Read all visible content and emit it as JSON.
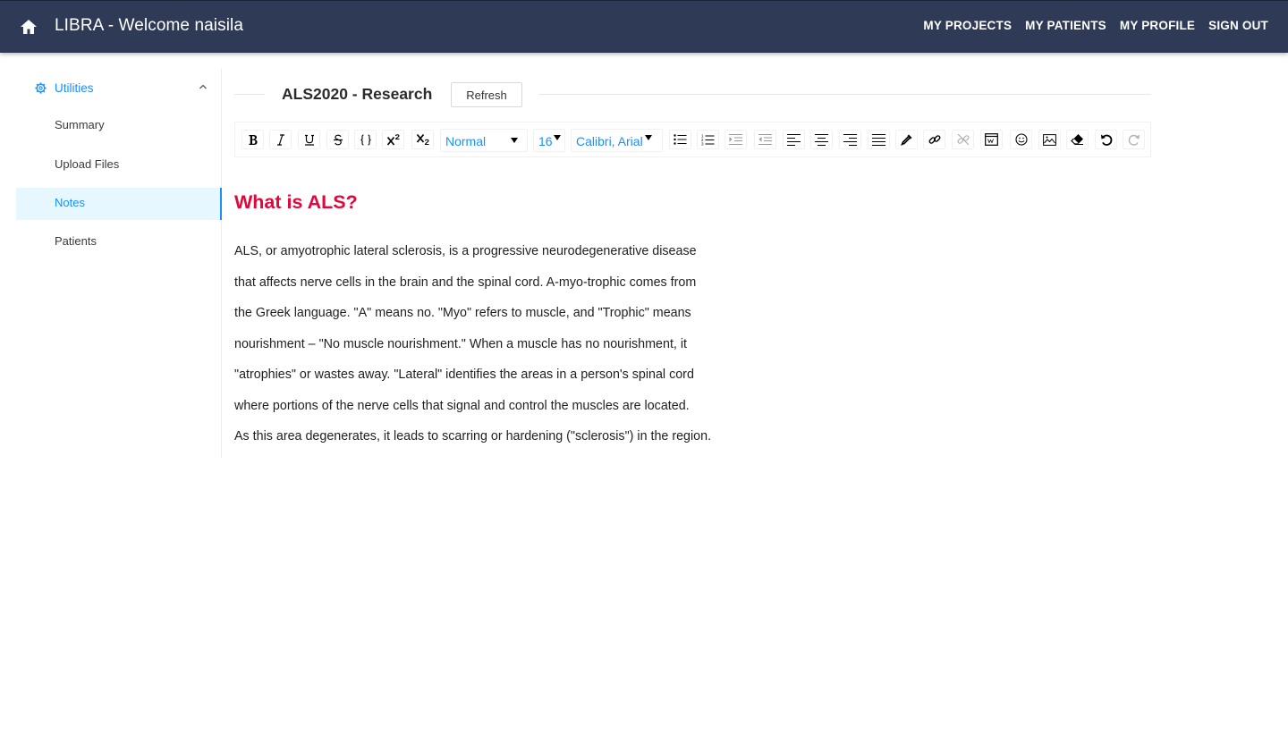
{
  "header": {
    "title": "LIBRA - Welcome naisila",
    "nav": [
      "MY PROJECTS",
      "MY PATIENTS",
      "MY PROFILE",
      "SIGN OUT"
    ],
    "background_color": "#2e3a56"
  },
  "sidebar": {
    "submenu": {
      "label": "Utilities",
      "icon": "gear-icon",
      "expanded": true
    },
    "items": [
      {
        "label": "Summary",
        "active": false
      },
      {
        "label": "Upload Files",
        "active": false
      },
      {
        "label": "Notes",
        "active": true
      },
      {
        "label": "Patients",
        "active": false
      }
    ],
    "accent_color": "#1890ff"
  },
  "page": {
    "title": "ALS2020 - Research",
    "refresh_label": "Refresh"
  },
  "toolbar": {
    "block_type": "Normal",
    "font_size": "16",
    "font_family": "Calibri, Arial",
    "buttons": [
      "bold",
      "italic",
      "underline",
      "strikethrough",
      "monospace",
      "superscript",
      "subscript",
      "unordered-list",
      "ordered-list",
      "indent",
      "outdent",
      "align-left",
      "align-center",
      "align-right",
      "align-justify",
      "color-picker",
      "link",
      "unlink",
      "embedded",
      "emoji",
      "image",
      "remove",
      "undo",
      "redo"
    ]
  },
  "editor": {
    "heading": "What is ALS?",
    "heading_color": "#e2063b",
    "lines": [
      "ALS, or amyotrophic lateral sclerosis, is a progressive neurodegenerative disease",
      "that affects nerve cells in the brain and the spinal cord. A-myo-trophic comes from",
      "the Greek language. \"A\" means no. \"Myo\" refers to muscle, and \"Trophic\" means",
      "nourishment – \"No muscle nourishment.\" When a muscle has no nourishment, it",
      "\"atrophies\" or wastes away. \"Lateral\" identifies the areas in a person's spinal cord",
      "where portions of the nerve cells that signal and control the muscles are located.",
      "As this area degenerates, it leads to scarring or hardening (\"sclerosis\") in the region."
    ]
  }
}
